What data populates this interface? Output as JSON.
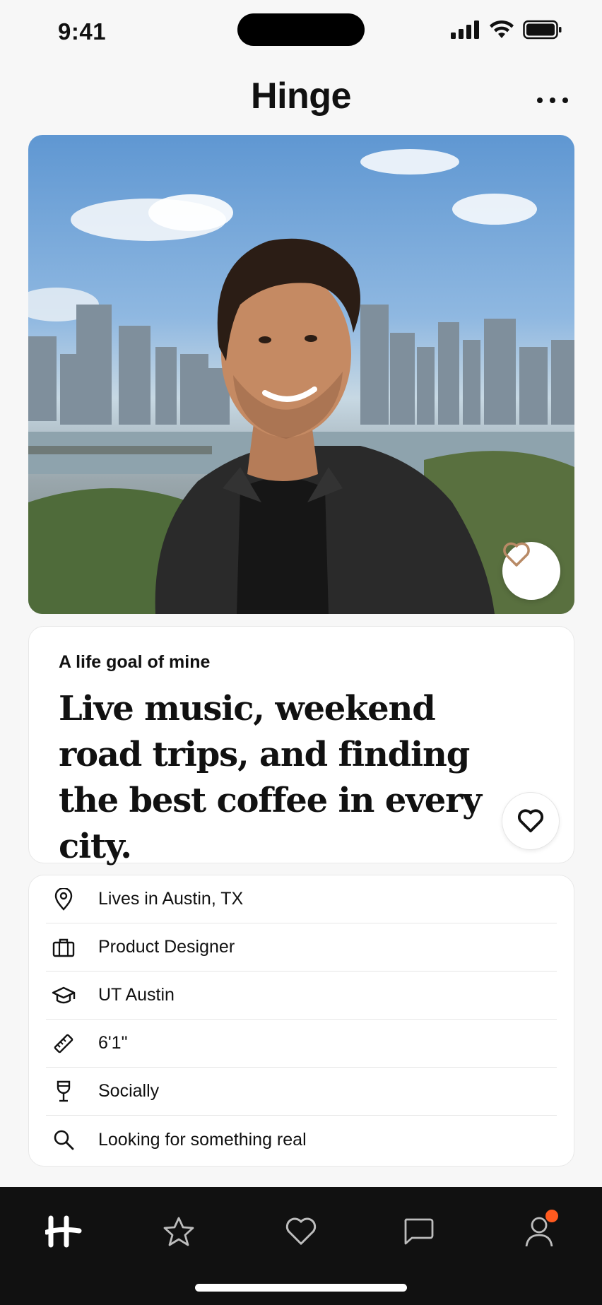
{
  "status_bar": {
    "time": "9:41"
  },
  "header": {
    "logo": "Hinge"
  },
  "photo": {
    "description_icon": "profile-photo",
    "like_icon": "heart-icon"
  },
  "prompt": {
    "label": "A life goal of mine",
    "answer": "Live music, weekend road trips, and finding the best coffee in every city."
  },
  "details": [
    {
      "icon": "location-pin-icon",
      "text": "Lives in Austin, TX"
    },
    {
      "icon": "briefcase-icon",
      "text": "Product Designer"
    },
    {
      "icon": "graduation-cap-icon",
      "text": "UT Austin"
    },
    {
      "icon": "ruler-icon",
      "text": "6'1\""
    },
    {
      "icon": "wine-glass-icon",
      "text": "Socially"
    },
    {
      "icon": "search-icon",
      "text": "Looking for something real"
    }
  ],
  "tab_bar": {
    "items": [
      "home",
      "standouts",
      "likes",
      "matches",
      "profile"
    ],
    "profile_notification": true,
    "notification_color": "#ff5a1f"
  },
  "colors": {
    "tab_bar_bg": "#111111",
    "accent": "#ff5a1f",
    "photo_heart": "#b88a66"
  }
}
